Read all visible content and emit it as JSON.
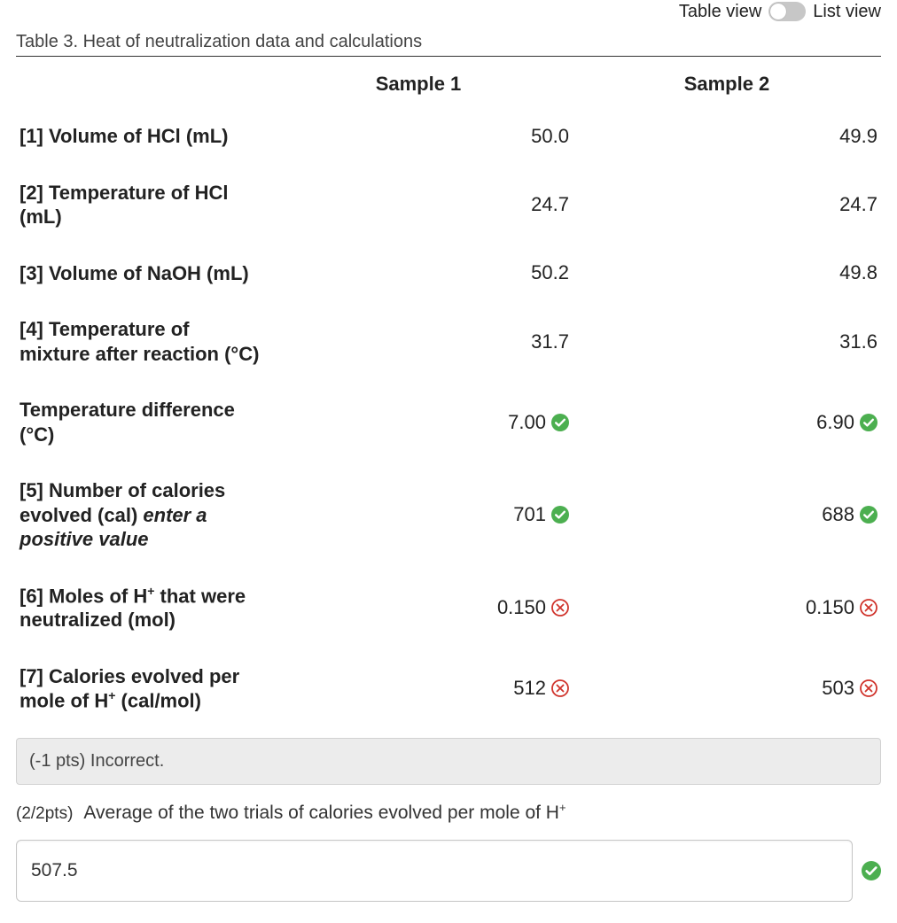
{
  "viewToggle": {
    "left": "Table view",
    "right": "List view",
    "state": "table"
  },
  "caption": "Table 3. Heat of neutralization data and calculations",
  "columns": [
    "Sample 1",
    "Sample 2"
  ],
  "rows": [
    {
      "label": "[1] Volume of HCl (mL)",
      "s1": {
        "v": "50.0",
        "mark": null
      },
      "s2": {
        "v": "49.9",
        "mark": null
      }
    },
    {
      "label": "[2] Temperature of HCl (mL)",
      "s1": {
        "v": "24.7",
        "mark": null
      },
      "s2": {
        "v": "24.7",
        "mark": null
      }
    },
    {
      "label": "[3] Volume of NaOH (mL)",
      "s1": {
        "v": "50.2",
        "mark": null
      },
      "s2": {
        "v": "49.8",
        "mark": null
      }
    },
    {
      "label": "[4] Temperature of mixture after reaction (°C)",
      "s1": {
        "v": "31.7",
        "mark": null
      },
      "s2": {
        "v": "31.6",
        "mark": null
      }
    },
    {
      "label": "Temperature difference (°C)",
      "s1": {
        "v": "7.00",
        "mark": "ok"
      },
      "s2": {
        "v": "6.90",
        "mark": "ok"
      }
    },
    {
      "label": "[5] Number of calories evolved (cal) <span class='hint'>enter a positive value</span>",
      "s1": {
        "v": "701",
        "mark": "ok"
      },
      "s2": {
        "v": "688",
        "mark": "ok"
      }
    },
    {
      "label": "[6] Moles of H<sup>+</sup> that were neutralized (mol)",
      "s1": {
        "v": "0.150",
        "mark": "bad"
      },
      "s2": {
        "v": "0.150",
        "mark": "bad"
      }
    },
    {
      "label": "[7] Calories evolved per mole of H<sup>+</sup> (cal/mol)",
      "s1": {
        "v": "512",
        "mark": "bad"
      },
      "s2": {
        "v": "503",
        "mark": "bad"
      }
    }
  ],
  "feedback": "(-1 pts) Incorrect.",
  "question": {
    "pts": "(2/2pts)",
    "text": "Average of the two trials of calories evolved per mole of H<sup>+</sup>"
  },
  "answer": {
    "value": "507.5",
    "mark": "ok"
  },
  "icons": {
    "ok": "check-circle-icon",
    "bad": "x-circle-icon"
  }
}
